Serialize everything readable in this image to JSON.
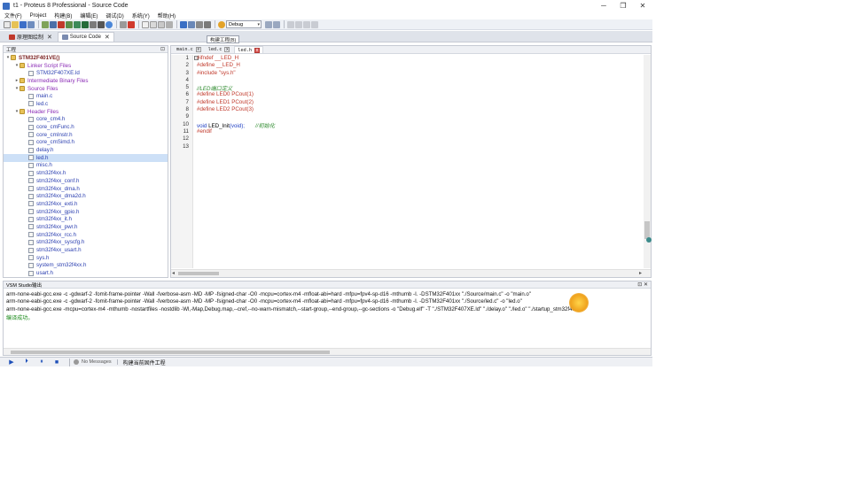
{
  "window": {
    "title": "t1 - Proteus 8 Professional - Source Code",
    "controls": [
      "─",
      "❐",
      "✕"
    ]
  },
  "menu": [
    "文件(F)",
    "Project",
    "构建(B)",
    "编辑(E)",
    "调试(D)",
    "系统(Y)",
    "帮助(H)"
  ],
  "toolbar": {
    "config_select": "Debug",
    "config_caret": "▾"
  },
  "tooltip": "构建工程(B)",
  "doc_tabs": [
    {
      "label": "原理图绘制",
      "close": "✕"
    },
    {
      "label": "Source Code",
      "close": "✕"
    }
  ],
  "project_panel": {
    "title": "工程",
    "pin": "⊡",
    "tree": [
      {
        "label": "STM32F401VE()",
        "kind": "root",
        "exp": "▾"
      },
      {
        "label": "Linker Script Files",
        "kind": "folder",
        "exp": "▾"
      },
      {
        "label": "STM32F407XE.ld",
        "kind": "file",
        "exp": ""
      },
      {
        "label": "Intermediate Binary Files",
        "kind": "folder",
        "exp": "▸"
      },
      {
        "label": "Source Files",
        "kind": "folder",
        "exp": "▾"
      },
      {
        "label": "main.c",
        "kind": "file",
        "exp": ""
      },
      {
        "label": "led.c",
        "kind": "file",
        "exp": ""
      },
      {
        "label": "Header Files",
        "kind": "folder",
        "exp": "▾"
      },
      {
        "label": "core_cm4.h",
        "kind": "file",
        "exp": ""
      },
      {
        "label": "core_cmFunc.h",
        "kind": "file",
        "exp": ""
      },
      {
        "label": "core_cmInstr.h",
        "kind": "file",
        "exp": ""
      },
      {
        "label": "core_cmSimd.h",
        "kind": "file",
        "exp": ""
      },
      {
        "label": "delay.h",
        "kind": "file",
        "exp": ""
      },
      {
        "label": "led.h",
        "kind": "file",
        "exp": "",
        "selected": true
      },
      {
        "label": "misc.h",
        "kind": "file",
        "exp": ""
      },
      {
        "label": "stm32f4xx.h",
        "kind": "file",
        "exp": ""
      },
      {
        "label": "stm32f4xx_conf.h",
        "kind": "file",
        "exp": ""
      },
      {
        "label": "stm32f4xx_dma.h",
        "kind": "file",
        "exp": ""
      },
      {
        "label": "stm32f4xx_dma2d.h",
        "kind": "file",
        "exp": ""
      },
      {
        "label": "stm32f4xx_exti.h",
        "kind": "file",
        "exp": ""
      },
      {
        "label": "stm32f4xx_gpio.h",
        "kind": "file",
        "exp": ""
      },
      {
        "label": "stm32f4xx_it.h",
        "kind": "file",
        "exp": ""
      },
      {
        "label": "stm32f4xx_pwr.h",
        "kind": "file",
        "exp": ""
      },
      {
        "label": "stm32f4xx_rcc.h",
        "kind": "file",
        "exp": ""
      },
      {
        "label": "stm32f4xx_syscfg.h",
        "kind": "file",
        "exp": ""
      },
      {
        "label": "stm32f4xx_usart.h",
        "kind": "file",
        "exp": ""
      },
      {
        "label": "sys.h",
        "kind": "file",
        "exp": ""
      },
      {
        "label": "system_stm32f4xx.h",
        "kind": "file",
        "exp": ""
      },
      {
        "label": "usart.h",
        "kind": "file",
        "exp": ""
      }
    ]
  },
  "editor": {
    "tabs": [
      {
        "label": "main.c",
        "active": false
      },
      {
        "label": "led.c",
        "active": false
      },
      {
        "label": "led.h",
        "active": true
      }
    ],
    "tab_close": "x",
    "fold_marker": "−",
    "lines": [
      {
        "n": "1",
        "parts": [
          {
            "t": "#ifndef __LED_H",
            "c": "pp"
          }
        ]
      },
      {
        "n": "2",
        "parts": [
          {
            "t": "#define __LED_H",
            "c": "pp"
          }
        ]
      },
      {
        "n": "3",
        "parts": [
          {
            "t": "#include \"sys.h\"",
            "c": "pp"
          }
        ]
      },
      {
        "n": "4",
        "parts": []
      },
      {
        "n": "5",
        "parts": [
          {
            "t": "//LED端口定义",
            "c": "cm"
          }
        ]
      },
      {
        "n": "6",
        "parts": [
          {
            "t": "#define LED0 PCout(1)",
            "c": "pp"
          }
        ]
      },
      {
        "n": "7",
        "parts": [
          {
            "t": "#define LED1 PCout(2)",
            "c": "pp"
          }
        ]
      },
      {
        "n": "8",
        "parts": [
          {
            "t": "#define LED2 PCout(3)",
            "c": "pp"
          }
        ]
      },
      {
        "n": "9",
        "parts": []
      },
      {
        "n": "10",
        "parts": [
          {
            "t": "void ",
            "c": "kw"
          },
          {
            "t": "LED_Init",
            "c": ""
          },
          {
            "t": "(void);",
            "c": "kw"
          },
          {
            "t": "       //初始化",
            "c": "cm"
          }
        ]
      },
      {
        "n": "11",
        "parts": [
          {
            "t": "#endif",
            "c": "pp"
          }
        ]
      },
      {
        "n": "12",
        "parts": []
      },
      {
        "n": "13",
        "parts": []
      }
    ],
    "hscroll_left": "◂",
    "hscroll_right": "▸"
  },
  "output": {
    "title": "VSM Studio输出",
    "buttons": "⊡ ✕",
    "lines": [
      {
        "text": "arm-none-eabi-gcc.exe -c -gdwarf-2 -fomit-frame-pointer -Wall -fverbose-asm -MD -MP -fsigned-char -O0 -mcpu=cortex-m4 -mfloat-abi=hard -mfpu=fpv4-sp-d16 -mthumb -I. -DSTM32F401xx   \"./Source/main.c\" -o \"main.o\"",
        "ok": false
      },
      {
        "text": "arm-none-eabi-gcc.exe -c -gdwarf-2 -fomit-frame-pointer -Wall -fverbose-asm -MD -MP -fsigned-char -O0 -mcpu=cortex-m4 -mfloat-abi=hard -mfpu=fpv4-sp-d16 -mthumb -I. -DSTM32F401xx   \"./Source/led.c\" -o \"led.o\"",
        "ok": false
      },
      {
        "text": "arm-none-eabi-gcc.exe -mcpu=cortex-m4 -mthumb -nostartfiles -nostdlib  -Wl,-Map,Debug.map,--cref,--no-warn-mismatch,--start-group,--end-group,--gc-sections -o \"Debug.elf\"  -T \"./STM32F407XE.ld\" \"./delay.o\" \"./led.o\" \"./startup_stm32f4xx.o\"",
        "ok": false
      },
      {
        "text": "编译成功。",
        "ok": true
      }
    ]
  },
  "status": {
    "play": "▶",
    "step": "⏵",
    "pause": "⏸",
    "stop": "■",
    "messages": "No Messages",
    "build_msg": "构建当前固件工程"
  }
}
